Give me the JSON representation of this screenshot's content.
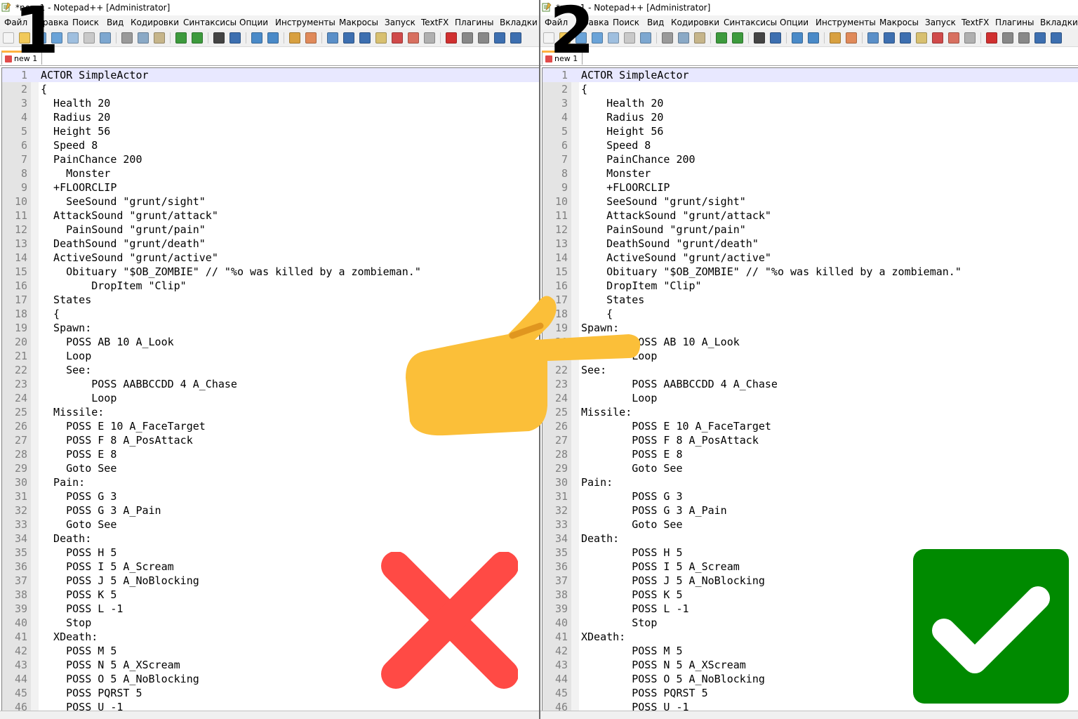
{
  "labels": {
    "left_number": "1",
    "right_number": "2"
  },
  "colors": {
    "cross": "#ff4a45",
    "check_bg": "#008a00",
    "hand": "#fbbf39",
    "hand_shadow": "#e0961f",
    "tab_accent": "#ffb23f"
  },
  "icons": {
    "hand": "pointing-hand-emoji",
    "cross": "red-cross-mark",
    "check": "white-check-mark-on-green"
  },
  "left": {
    "title": "*new 1 - Notepad++ [Administrator]",
    "menu": [
      "Файл",
      "Правка",
      "Поиск",
      "Вид",
      "Кодировки",
      "Синтаксисы",
      "Опции",
      "Инструменты",
      "Макросы",
      "Запуск",
      "TextFX",
      "Плагины",
      "Вкладки"
    ],
    "tab": "new 1",
    "lines": [
      "ACTOR SimpleActor",
      "{",
      "  Health 20",
      "  Radius 20",
      "  Height 56",
      "  Speed 8",
      "  PainChance 200",
      "    Monster",
      "  +FLOORCLIP",
      "    SeeSound \"grunt/sight\"",
      "  AttackSound \"grunt/attack\"",
      "    PainSound \"grunt/pain\"",
      "  DeathSound \"grunt/death\"",
      "  ActiveSound \"grunt/active\"",
      "    Obituary \"$OB_ZOMBIE\" // \"%o was killed by a zombieman.\"",
      "        DropItem \"Clip\"",
      "  States",
      "  {",
      "  Spawn:",
      "    POSS AB 10 A_Look",
      "    Loop",
      "    See:",
      "        POSS AABBCCDD 4 A_Chase",
      "        Loop",
      "  Missile:",
      "    POSS E 10 A_FaceTarget",
      "    POSS F 8 A_PosAttack",
      "    POSS E 8",
      "    Goto See",
      "  Pain:",
      "    POSS G 3",
      "    POSS G 3 A_Pain",
      "    Goto See",
      "  Death:",
      "    POSS H 5",
      "    POSS I 5 A_Scream",
      "    POSS J 5 A_NoBlocking",
      "    POSS K 5",
      "    POSS L -1",
      "    Stop",
      "  XDeath:",
      "    POSS M 5",
      "    POSS N 5 A_XScream",
      "    POSS O 5 A_NoBlocking",
      "    POSS PQRST 5",
      "    POSS U -1"
    ]
  },
  "right": {
    "title": "*new 1 - Notepad++ [Administrator]",
    "menu": [
      "Файл",
      "Правка",
      "Поиск",
      "Вид",
      "Кодировки",
      "Синтаксисы",
      "Опции",
      "Инструменты",
      "Макросы",
      "Запуск",
      "TextFX",
      "Плагины",
      "Вкладки"
    ],
    "tab": "new 1",
    "lines": [
      "ACTOR SimpleActor",
      "{",
      "    Health 20",
      "    Radius 20",
      "    Height 56",
      "    Speed 8",
      "    PainChance 200",
      "    Monster",
      "    +FLOORCLIP",
      "    SeeSound \"grunt/sight\"",
      "    AttackSound \"grunt/attack\"",
      "    PainSound \"grunt/pain\"",
      "    DeathSound \"grunt/death\"",
      "    ActiveSound \"grunt/active\"",
      "    Obituary \"$OB_ZOMBIE\" // \"%o was killed by a zombieman.\"",
      "    DropItem \"Clip\"",
      "    States",
      "    {",
      "Spawn:",
      "        POSS AB 10 A_Look",
      "        Loop",
      "See:",
      "        POSS AABBCCDD 4 A_Chase",
      "        Loop",
      "Missile:",
      "        POSS E 10 A_FaceTarget",
      "        POSS F 8 A_PosAttack",
      "        POSS E 8",
      "        Goto See",
      "Pain:",
      "        POSS G 3",
      "        POSS G 3 A_Pain",
      "        Goto See",
      "Death:",
      "        POSS H 5",
      "        POSS I 5 A_Scream",
      "        POSS J 5 A_NoBlocking",
      "        POSS K 5",
      "        POSS L -1",
      "        Stop",
      "XDeath:",
      "        POSS M 5",
      "        POSS N 5 A_XScream",
      "        POSS O 5 A_NoBlocking",
      "        POSS PQRST 5",
      "        POSS U -1"
    ]
  }
}
